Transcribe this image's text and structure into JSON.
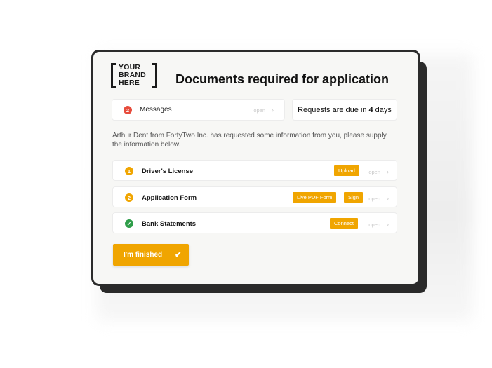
{
  "brand": {
    "logo_text": "YOUR\nBRAND\nHERE"
  },
  "title": "Documents required for application",
  "messages": {
    "count": "2",
    "label": "Messages",
    "open_label": "open"
  },
  "due": {
    "prefix": "Requests are due in",
    "value": "4",
    "suffix": "days"
  },
  "intro_text": "Arthur Dent from FortyTwo Inc. has requested some information from you, please supply the information below.",
  "documents": [
    {
      "badge": "1",
      "label": "Driver's License",
      "actions": [
        "Upload"
      ],
      "open_label": "open",
      "status": "pending"
    },
    {
      "badge": "2",
      "label": "Application Form",
      "actions": [
        "Live PDF Form",
        "Sign"
      ],
      "open_label": "open",
      "status": "pending"
    },
    {
      "badge": "✓",
      "label": "Bank Statements",
      "actions": [
        "Connect"
      ],
      "open_label": "open",
      "status": "complete"
    }
  ],
  "finish_button": {
    "label": "I'm finished",
    "icon": "check-icon"
  },
  "colors": {
    "accent": "#f0a500",
    "alert": "#e74c3c",
    "success": "#2f9e4a",
    "frame": "#2b2b2b"
  }
}
